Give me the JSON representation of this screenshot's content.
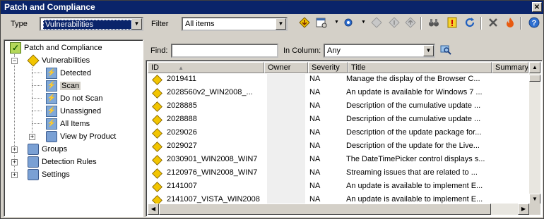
{
  "window": {
    "title": "Patch and Compliance",
    "close_glyph": "✕"
  },
  "toolbar": {
    "type_label": "Type",
    "type_value": "Vulnerabilities",
    "filter_label": "Filter",
    "filter_value": "All items",
    "icons": [
      "download-icon",
      "schedule-icon",
      "gear-icon",
      "repair-icon",
      "rollback-icon",
      "uninstall-icon",
      "binoculars-icon",
      "alert-icon",
      "refresh-icon",
      "delete-icon",
      "purge-icon",
      "help-icon"
    ]
  },
  "tree": {
    "root": "Patch and Compliance",
    "vulnerabilities": "Vulnerabilities",
    "detected": "Detected",
    "scan": "Scan",
    "do_not_scan": "Do not Scan",
    "unassigned": "Unassigned",
    "all_items": "All Items",
    "view_by_product": "View by Product",
    "groups": "Groups",
    "detection_rules": "Detection Rules",
    "settings": "Settings"
  },
  "find": {
    "find_label": "Find:",
    "find_value": "",
    "in_column_label": "In Column:",
    "in_column_value": "Any"
  },
  "grid": {
    "columns": {
      "id": "ID",
      "owner": "Owner",
      "severity": "Severity",
      "title": "Title",
      "summary": "Summary"
    },
    "rows": [
      {
        "id": "2019411",
        "owner": "",
        "severity": "NA",
        "title": "Manage the display of the Browser C..."
      },
      {
        "id": "2028560v2_WIN2008_...",
        "owner": "",
        "severity": "NA",
        "title": "An update is available for Windows 7 ..."
      },
      {
        "id": "2028885",
        "owner": "",
        "severity": "NA",
        "title": "Description of the cumulative update ..."
      },
      {
        "id": "2028888",
        "owner": "",
        "severity": "NA",
        "title": "Description of the cumulative update ..."
      },
      {
        "id": "2029026",
        "owner": "",
        "severity": "NA",
        "title": "Description of the update package for..."
      },
      {
        "id": "2029027",
        "owner": "",
        "severity": "NA",
        "title": "Description of the update for the Live..."
      },
      {
        "id": "2030901_WIN2008_WIN7",
        "owner": "",
        "severity": "NA",
        "title": "The DateTimePicker control displays s..."
      },
      {
        "id": "2120976_WIN2008_WIN7",
        "owner": "",
        "severity": "NA",
        "title": "Streaming issues that are related to ..."
      },
      {
        "id": "2141007",
        "owner": "",
        "severity": "NA",
        "title": "An update is available to implement E..."
      },
      {
        "id": "2141007_VISTA_WIN2008",
        "owner": "",
        "severity": "NA",
        "title": "An update is available to implement E..."
      }
    ]
  }
}
